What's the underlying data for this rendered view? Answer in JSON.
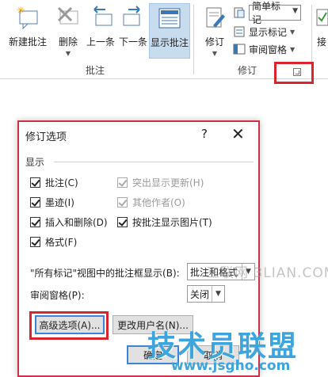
{
  "ribbon": {
    "buttons": {
      "new_comment": "新建批注",
      "delete": "删除",
      "previous": "上一条",
      "next": "下一条",
      "show_comments": "显示批注",
      "revise": "修订",
      "accept_partial": "接"
    },
    "groups": {
      "comments": "批注",
      "tracking": "修订"
    },
    "markup_combo": "简单标记",
    "show_markup": "显示标记",
    "reviewing_pane": "审阅窗格"
  },
  "dialog": {
    "title": "修订选项",
    "help": "?",
    "close": "✕",
    "section_show": "显示",
    "checks": [
      {
        "label": "批注(C)",
        "checked": true,
        "enabled": true
      },
      {
        "label": "突出显示更新(H)",
        "checked": true,
        "enabled": false
      },
      {
        "label": "墨迹(I)",
        "checked": true,
        "enabled": true
      },
      {
        "label": "其他作者(O)",
        "checked": true,
        "enabled": false
      },
      {
        "label": "插入和删除(D)",
        "checked": true,
        "enabled": true
      },
      {
        "label": "按批注显示图片(T)",
        "checked": true,
        "enabled": true
      },
      {
        "label": "格式(F)",
        "checked": true,
        "enabled": true
      }
    ],
    "balloon_label": "\"所有标记\"视图中的批注框显示(B):",
    "balloon_value": "批注和格式",
    "pane_label": "审阅窗格(P):",
    "pane_value": "关闭",
    "advanced_button": "高级选项(A)...",
    "change_user_button": "更改用户名(N)...",
    "ok_button": "确定",
    "cancel_button": "取消"
  },
  "watermarks": {
    "site_text": "三联网 3LIAN.COM",
    "brand_text": "技术员联盟",
    "url_text": "www.jsgho.com"
  },
  "colors": {
    "highlight_red": "#d9262e",
    "selected_blue": "#c8dcf0",
    "brand_blue": "#3da4dc"
  }
}
